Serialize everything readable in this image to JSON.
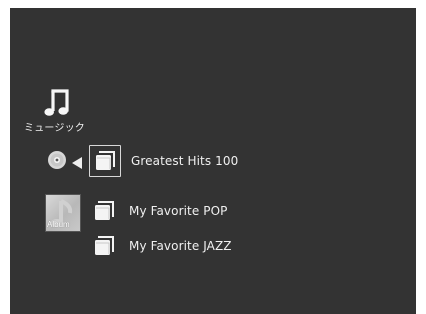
{
  "category": {
    "label": "ミュージック",
    "icon": "music-note-icon"
  },
  "playlists": [
    {
      "label": "Greatest Hits 100",
      "selected": true,
      "icon": "folder-icon"
    },
    {
      "label": "My Favorite POP",
      "selected": false,
      "icon": "folder-icon"
    },
    {
      "label": "My Favorite JAZZ",
      "selected": false,
      "icon": "folder-icon"
    }
  ],
  "album": {
    "label": "Album",
    "icon": "album-art-icon"
  },
  "colors": {
    "screen_background": "#333333",
    "text": "#f0f0f0",
    "selection_border": "#d8d8d8"
  }
}
